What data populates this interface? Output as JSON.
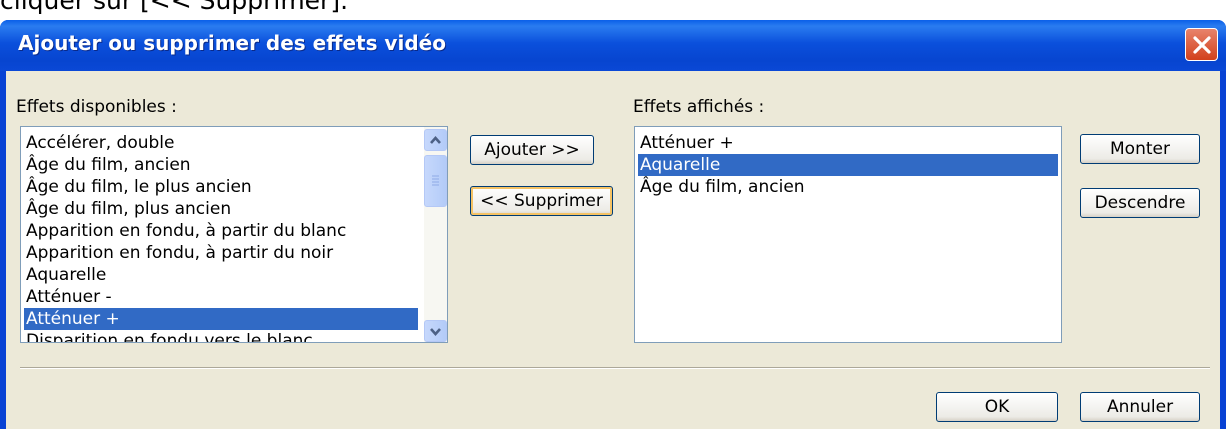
{
  "top_fragment": "cliquer sur [<< Supprimer].",
  "window": {
    "title": "Ajouter ou supprimer des effets vidéo"
  },
  "available": {
    "label": "Effets disponibles :",
    "items": [
      "Accélérer, double",
      "Âge du film, ancien",
      "Âge du film, le plus ancien",
      "Âge du film, plus ancien",
      "Apparition en fondu, à partir du blanc",
      "Apparition en fondu, à partir du noir",
      "Aquarelle",
      "Atténuer -",
      "Atténuer +",
      "Disparition en fondu vers le blanc"
    ],
    "selected_index": 8
  },
  "displayed": {
    "label": "Effets affichés :",
    "items": [
      "Atténuer +",
      "Aquarelle",
      "Âge du film, ancien"
    ],
    "selected_index": 1
  },
  "buttons": {
    "add": "Ajouter >>",
    "remove": "<< Supprimer",
    "up": "Monter",
    "down": "Descendre",
    "ok": "OK",
    "cancel": "Annuler"
  },
  "colors": {
    "titlebar": "#0842d4",
    "selection": "#316ac5",
    "dialog_face": "#ece9d8",
    "close_button": "#d2411c"
  }
}
